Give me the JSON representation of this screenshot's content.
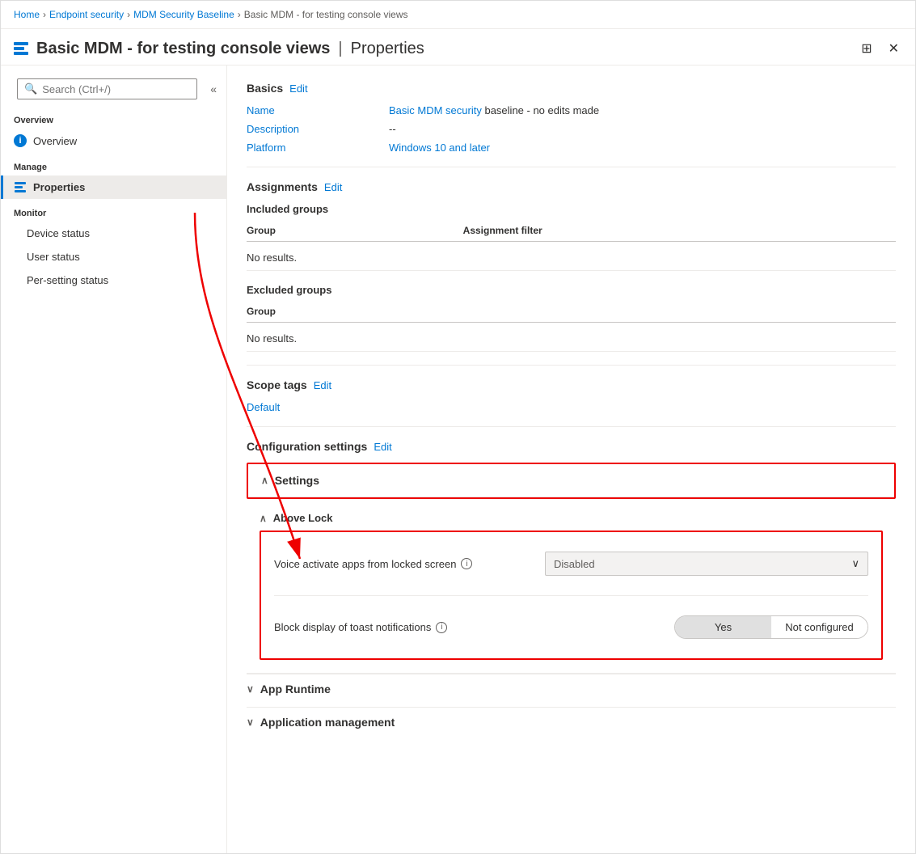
{
  "breadcrumb": {
    "items": [
      "Home",
      "Endpoint security",
      "MDM Security Baseline",
      "Basic MDM - for testing console views"
    ]
  },
  "header": {
    "title": "Basic MDM - for testing console views",
    "separator": "|",
    "subtitle": "Properties",
    "pin_icon": "📌",
    "close_icon": "✕"
  },
  "search": {
    "placeholder": "Search (Ctrl+/)"
  },
  "sidebar": {
    "overview_section": "Overview",
    "overview_item": "Overview",
    "manage_section": "Manage",
    "properties_item": "Properties",
    "monitor_section": "Monitor",
    "device_status": "Device status",
    "user_status": "User status",
    "per_setting_status": "Per-setting status",
    "collapse_icon": "«"
  },
  "basics": {
    "section_title": "Basics",
    "edit_label": "Edit",
    "name_label": "Name",
    "name_value_prefix": "Basic MDM security",
    "name_value_suffix": " baseline - no edits made",
    "description_label": "Description",
    "description_value": "--",
    "platform_label": "Platform",
    "platform_value": "Windows 10 and later"
  },
  "assignments": {
    "section_title": "Assignments",
    "edit_label": "Edit",
    "included_groups_title": "Included groups",
    "group_col": "Group",
    "assignment_filter_col": "Assignment filter",
    "no_results": "No results.",
    "excluded_groups_title": "Excluded groups",
    "group_col2": "Group",
    "no_results2": "No results."
  },
  "scope_tags": {
    "section_title": "Scope tags",
    "edit_label": "Edit",
    "default_tag": "Default"
  },
  "config_settings": {
    "section_title": "Configuration settings",
    "edit_label": "Edit",
    "settings_accordion": "Settings",
    "above_lock_label": "Above Lock",
    "voice_activate_label": "Voice activate apps from locked screen",
    "voice_activate_value": "Disabled",
    "block_toast_label": "Block display of toast notifications",
    "toggle_yes": "Yes",
    "toggle_not_configured": "Not configured",
    "app_runtime_label": "App Runtime",
    "app_management_label": "Application management"
  }
}
